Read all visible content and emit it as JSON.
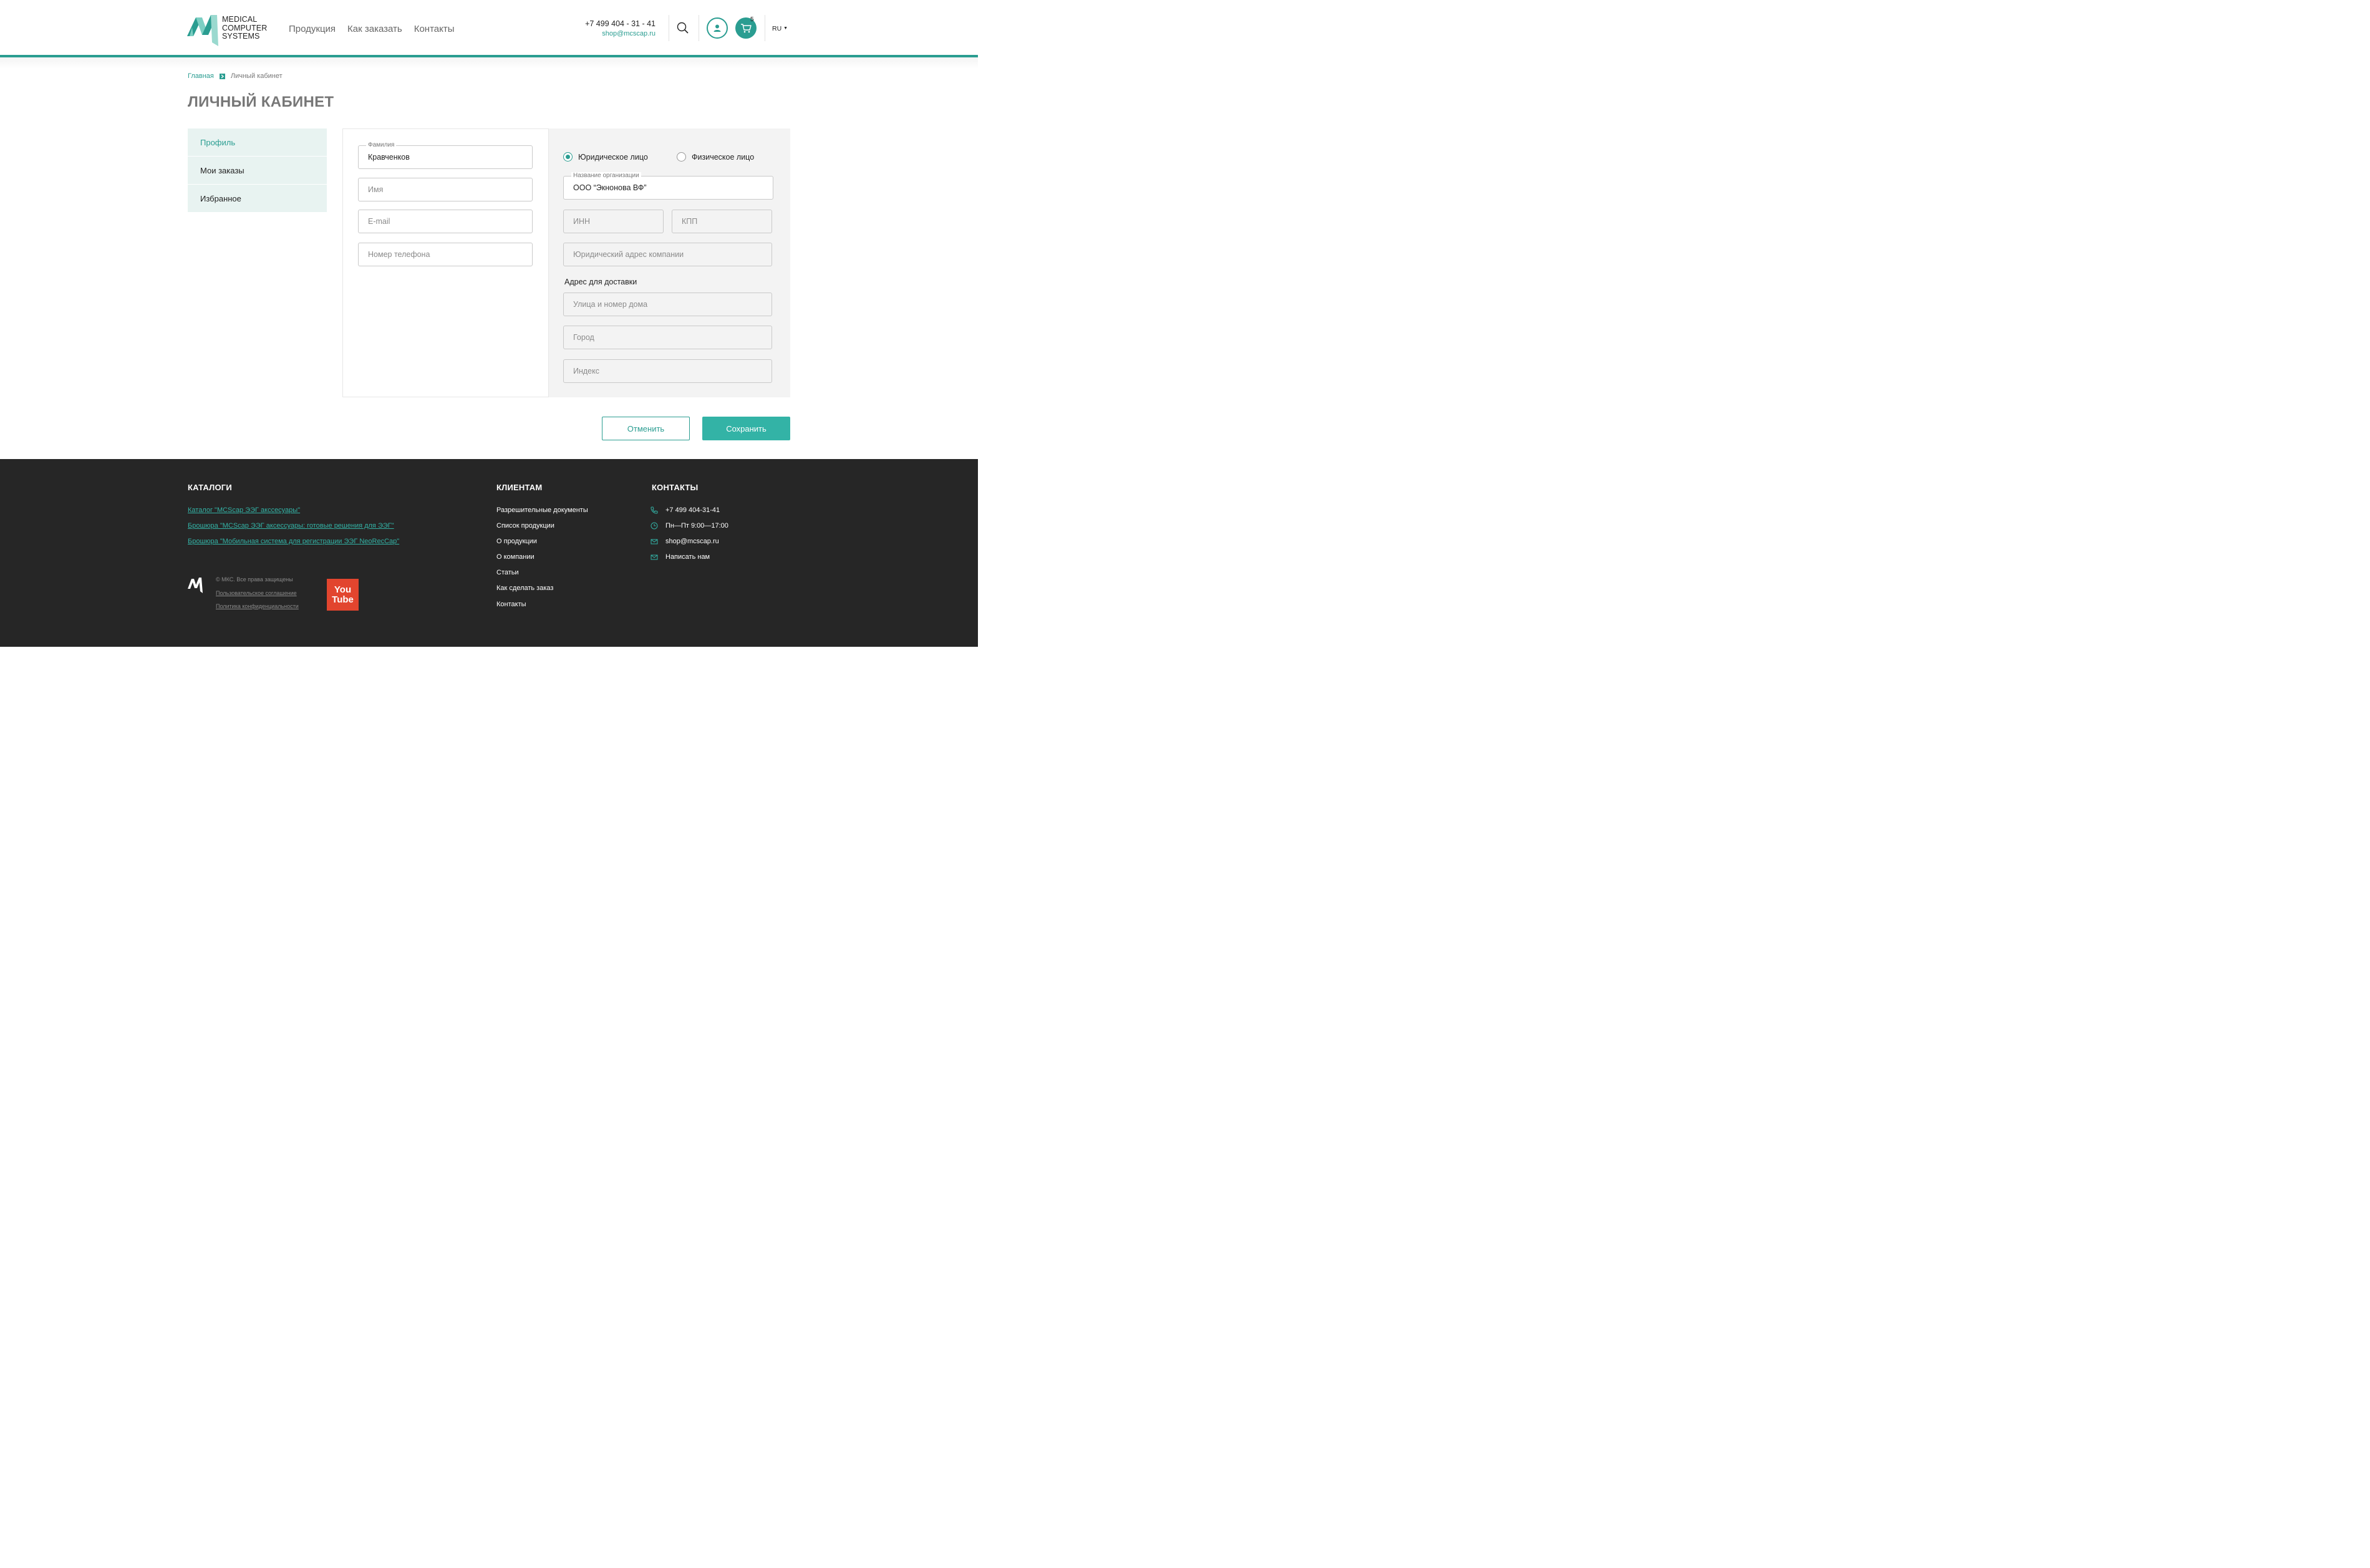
{
  "brand": {
    "logo_line1": "MEDICAL",
    "logo_line2": "COMPUTER",
    "logo_line3": "SYSTEMS",
    "accent_color": "#2a9d91",
    "button_color": "#33b3a6"
  },
  "nav": {
    "products": "Продукция",
    "how_to_order": "Как заказать",
    "contacts": "Контакты"
  },
  "header": {
    "phone": "+7 499 404 - 31 - 41",
    "email": "shop@mcscap.ru",
    "cart_count": "5",
    "lang": "RU",
    "icons": [
      "search-icon",
      "user-icon",
      "cart-icon",
      "chevron-down-icon"
    ]
  },
  "breadcrumb": {
    "home": "Главная",
    "current": "Личный кабинет"
  },
  "page_title": "ЛИЧНЫЙ КАБИНЕТ",
  "sidebar": {
    "items": [
      {
        "label": "Профиль"
      },
      {
        "label": "Мои заказы"
      },
      {
        "label": "Избранное"
      }
    ]
  },
  "personal": {
    "surname_label": "Фамилия",
    "surname_value": "Кравченков",
    "name_placeholder": "Имя",
    "email_placeholder": "E-mail",
    "phone_placeholder": "Номер телефона"
  },
  "company": {
    "radio_legal": "Юридическое лицо",
    "radio_individual": "Физическое лицо",
    "org_label": "Название организации",
    "org_value": "ООО “Экнонова ВФ”",
    "inn_placeholder": "ИНН",
    "kpp_placeholder": "КПП",
    "legal_address_placeholder": "Юридический адрес компании",
    "delivery_title": "Адрес для доставки",
    "street_placeholder": "Улица и номер дома",
    "city_placeholder": "Город",
    "index_placeholder": "Индекс"
  },
  "actions": {
    "cancel": "Отменить",
    "save": "Сохранить"
  },
  "footer": {
    "catalogs_title": "КАТАЛОГИ",
    "catalogs": [
      "Каталог \"MCScap ЭЭГ акссесуары\"",
      "Брошюра \"MCScap ЭЭГ аксессуары: готовые решения для ЭЭГ\"",
      "Брошюра \"Мобильная система для регистрации ЭЭГ NeoRecCap\""
    ],
    "clients_title": "КЛИЕНТАМ",
    "clients": [
      "Разрешительные документы",
      "Список продукции",
      "О продукции",
      "О компании",
      "Статьи",
      "Как сделать заказ",
      "Контакты"
    ],
    "contacts_title": "КОНТАКТЫ",
    "contacts": [
      {
        "icon": "phone-icon",
        "text": "+7 499 404-31-41"
      },
      {
        "icon": "clock-icon",
        "text": "Пн—Пт 9:00—17:00"
      },
      {
        "icon": "mail-icon",
        "text": "shop@mcscap.ru"
      },
      {
        "icon": "mail-icon",
        "text": "Написать нам"
      }
    ],
    "copyright": "© МКС. Все права защищены",
    "user_agreement": "Пользовательское соглашение",
    "privacy_policy": "Политика конфиденциальности",
    "youtube_line1": "You",
    "youtube_line2": "Tube"
  }
}
